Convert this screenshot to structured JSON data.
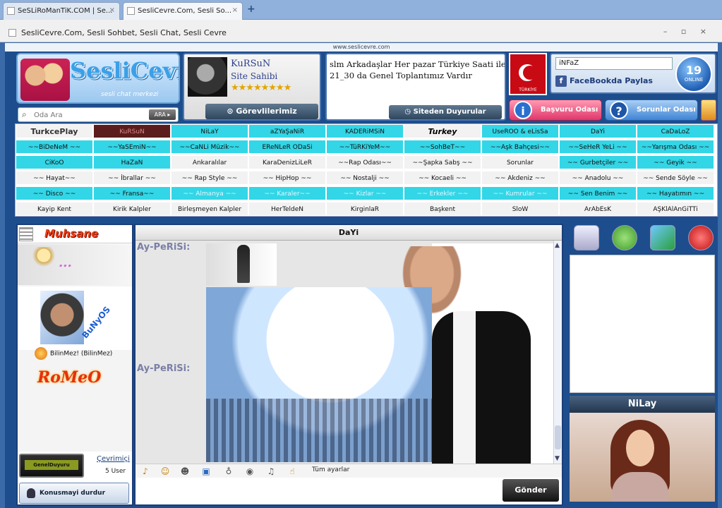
{
  "browser": {
    "tabs": [
      {
        "label": "SeSLiRoManTiK.COM | Se...",
        "close": "×"
      },
      {
        "label": "SesliCevre.Com, Sesli So...",
        "close": "×"
      }
    ],
    "new_tab": "+",
    "window_title": "SesliCevre.Com, Sesli Sohbet, Sesli Chat, Sesli Cevre",
    "window_controls": "– ▫ ×"
  },
  "page": {
    "url": "www.seslicevre.com",
    "logo": {
      "title": "SesliCevre",
      "subtitle": "sesli chat merkezi"
    },
    "search": {
      "placeholder": "Oda Ara",
      "button": "ARA ▸",
      "icon": "⌕"
    },
    "owner": {
      "name": "KuRSuN",
      "role": "Site Sahibi",
      "stars": "★★★★★★★★",
      "button": "⊙ Görevlilerimiz"
    },
    "announcement": {
      "text": "slm Arkadaşlar Her pazar Türkiye Saati ile 21_30 da Genel Toplantımız Vardır",
      "button": "◷ Siteden Duyurular"
    },
    "flag_label": "TÜRKİYE",
    "user": {
      "name": "iNFaZ",
      "facebook": "FaceBookda Paylas",
      "fb_icon": "f"
    },
    "online": {
      "count": "19",
      "label": "ONLINE"
    },
    "buttons": {
      "apply": "Başvuru Odası",
      "apply_icon": "i",
      "issues": "Sorunlar Odası",
      "issues_icon": "?"
    }
  },
  "rooms": [
    [
      "TurkcePlay",
      "KuRSuN",
      "NiLaY",
      "aZYaŞaNiR",
      "KADERiMSiN",
      "Turkey",
      "UseROO & eLisSa",
      "DaYi",
      "CaDaLoZ"
    ],
    [
      "~~BiDeNeM ~~",
      "~~YaSEmiN~~",
      "~~CaNLi Müzik~~",
      "EReNLeR ODaSi",
      "~~TüRKiYeM~~",
      "~~SohBeT~~",
      "~~Aşk Bahçesi~~",
      "~~SeHeR YeLi ~~",
      "~~Yarışma Odası ~~"
    ],
    [
      "CiKoO",
      "HaZaN",
      "Ankaralılar",
      "KaraDenizLiLeR",
      "~~Rap Odası~~",
      "~~Şapka Sabş ~~",
      "Sorunlar",
      "~~ Gurbetçiler ~~",
      "~~ Geyik ~~"
    ],
    [
      "~~ Hayat~~",
      "~~ İbrallar ~~",
      "~~ Rap Style ~~",
      "~~ HipHop ~~",
      "~~ Nostalji ~~",
      "~~ Kocaeli ~~",
      "~~ Akdeniz ~~",
      "~~ Anadolu ~~",
      "~~ Sende Söyle ~~"
    ],
    [
      "~~ Disco ~~",
      "~~ Fransa~~",
      "~~ Almanya ~~",
      "~~ Karaler~~",
      "~~ Kizlar ~~",
      "~~ Erkekler ~~",
      "~~ Kumrular ~~",
      "~~ Sen Benim ~~",
      "~~ Hayatımın ~~"
    ],
    [
      "Kayip Kent",
      "Kirik Kalpler",
      "Birleşmeyen Kalpler",
      "HerTeldeN",
      "KirginlaR",
      "Başkent",
      "SloW",
      "ArAbEsK",
      "AŞKlAlAnGiTTi"
    ]
  ],
  "left_panel": {
    "header_tag": "Muhsane",
    "users": [
      "...",
      "BuNyOS",
      "BilinMez! (BilinMez)",
      "RoMeO"
    ],
    "ad_text": "GenelDuyuru",
    "online_link": "Çevrimiçi",
    "user_count": "5 User",
    "stop_button": "Konusmayi durdur"
  },
  "chat": {
    "title": "DaYi",
    "messages": [
      {
        "nick": "Ay-PeRiSi:"
      },
      {
        "nick": "Ay-PeRiSi:"
      }
    ],
    "tools_label": "Tüm ayarlar",
    "send_button": "Gönder",
    "scroll_up": "▲",
    "scroll_down": "▼"
  },
  "right_panel": {
    "cam_user": "NiLay"
  },
  "colors": {
    "cyan_cell": "#33d6e6",
    "page_bg": "#1d4d8c",
    "accent_red": "#e0366a"
  }
}
